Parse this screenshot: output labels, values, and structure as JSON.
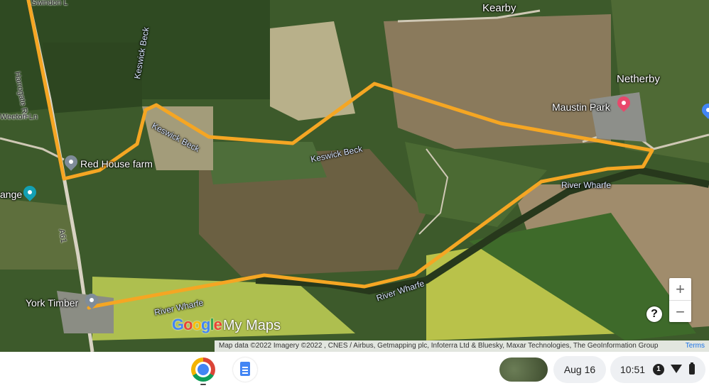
{
  "map": {
    "places": {
      "kearby": "Kearby",
      "netherby": "Netherby",
      "maustin_park": "Maustin Park",
      "red_house_farm": "Red House farm",
      "york_timber": "York Timber",
      "grange": "ange"
    },
    "roads": {
      "swindon": "Swindon L",
      "harrogate": "Harrogate Rd",
      "weeton": "Weeton Ln",
      "a61": "A61"
    },
    "water": {
      "keswick_beck_1": "Keswick Beck",
      "keswick_beck_2": "Keswick Beck",
      "keswick_beck_3": "Keswick Beck",
      "river_wharfe_1": "River Wharfe",
      "river_wharfe_2": "River Wharfe",
      "river_wharfe_3": "River Wharfe"
    },
    "logo": {
      "g": "G",
      "o1": "o",
      "o2": "o",
      "g2": "g",
      "l": "l",
      "e": "e",
      "suffix": "My Maps"
    },
    "attribution": "Map data ©2022 Imagery ©2022 , CNES / Airbus, Getmapping plc, Infoterra Ltd & Bluesky, Maxar Technologies, The GeoInformation Group",
    "terms": "Terms",
    "zoom_in": "+",
    "zoom_out": "−",
    "help": "?",
    "route_color": "#f5a623"
  },
  "shelf": {
    "date": "Aug 16",
    "time": "10:51",
    "notification_count": "1",
    "apps": [
      "chrome-icon",
      "docs-icon"
    ]
  }
}
